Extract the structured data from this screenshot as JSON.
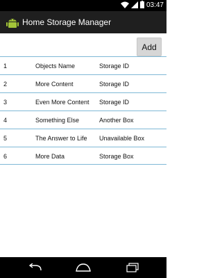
{
  "status_bar": {
    "time": "03:47",
    "icons": [
      "wifi-icon",
      "cell-signal-icon",
      "battery-icon"
    ]
  },
  "action_bar": {
    "app_icon": "android-icon",
    "title": "Home Storage Manager"
  },
  "toolbar": {
    "add_label": "Add"
  },
  "table": {
    "rows": [
      {
        "num": "1",
        "name": "Objects Name",
        "storage": "Storage ID"
      },
      {
        "num": "2",
        "name": "More Content",
        "storage": "Storage ID"
      },
      {
        "num": "3",
        "name": "Even More Content",
        "storage": "Storage ID"
      },
      {
        "num": "4",
        "name": "Something Else",
        "storage": "Another Box"
      },
      {
        "num": "5",
        "name": "The Answer to Life",
        "storage": "Unavailable Box"
      },
      {
        "num": "6",
        "name": "More Data",
        "storage": "Storage Box"
      }
    ]
  },
  "nav_bar": {
    "buttons": [
      "back-icon",
      "home-icon",
      "recent-apps-icon"
    ]
  },
  "colors": {
    "divider": "#7fb8d6",
    "action_bar": "#1f1f1f",
    "button": "#d6d6d6"
  }
}
